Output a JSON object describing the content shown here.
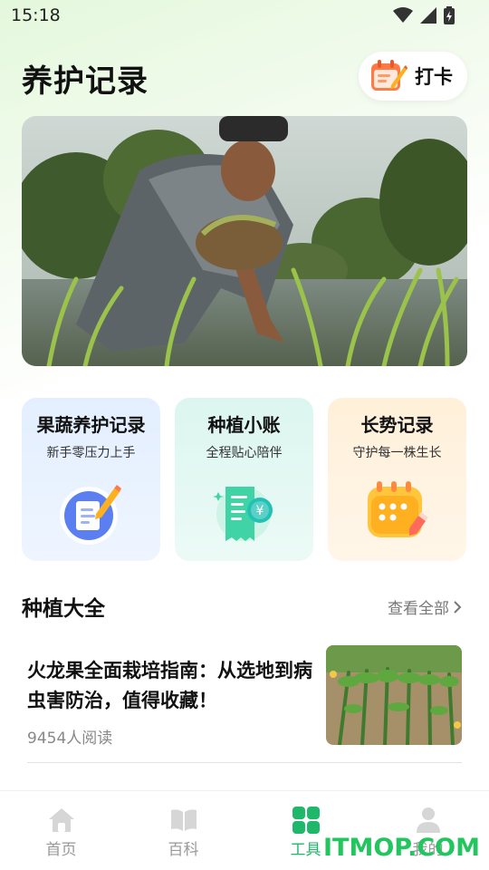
{
  "status_bar": {
    "time": "15:18"
  },
  "header": {
    "title": "养护记录",
    "checkin_label": "打卡"
  },
  "tools": [
    {
      "title": "果蔬养护记录",
      "subtitle": "新手零压力上手",
      "icon": "notebook-pencil-icon"
    },
    {
      "title": "种植小账",
      "subtitle": "全程贴心陪伴",
      "icon": "receipt-yen-icon"
    },
    {
      "title": "长势记录",
      "subtitle": "守护每一株生长",
      "icon": "calendar-pencil-icon"
    }
  ],
  "section": {
    "title": "种植大全",
    "view_all": "查看全部"
  },
  "article": {
    "title": "火龙果全面栽培指南：从选地到病虫害防治，值得收藏！",
    "reads": "9454人阅读"
  },
  "tabs": [
    {
      "label": "首页",
      "icon": "home-icon",
      "active": false
    },
    {
      "label": "百科",
      "icon": "book-icon",
      "active": false
    },
    {
      "label": "工具",
      "icon": "grid-icon",
      "active": true
    },
    {
      "label": "我的",
      "icon": "user-icon",
      "active": false
    }
  ],
  "watermark": "ITMOP.COM",
  "colors": {
    "accent": "#1fb86a",
    "watermark": "#22c55e"
  }
}
